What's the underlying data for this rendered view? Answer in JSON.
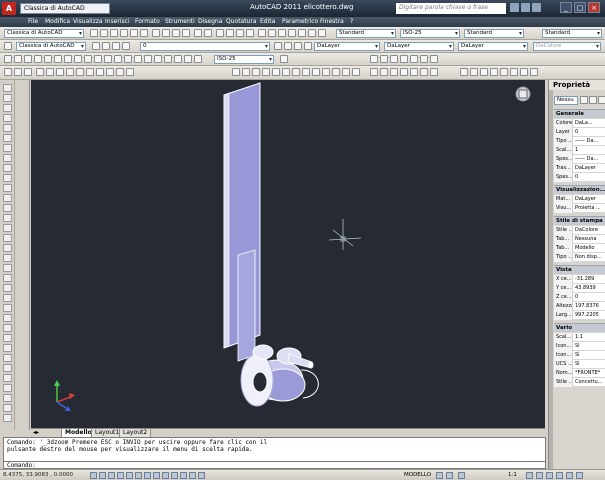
{
  "titlebar": {
    "workspace": "Classica di AutoCAD",
    "title": "AutoCAD 2011   elicottero.dwg",
    "search_placeholder": "Digitare parola chiave o frase",
    "logo": "A"
  },
  "menu": [
    "File",
    "Modifica",
    "Visualizza",
    "Inserisci",
    "Formato",
    "Strumenti",
    "Disegna",
    "Quotatura",
    "Edita",
    "Parametrico",
    "Finestra",
    "?"
  ],
  "toolbars": {
    "workspace_combo": "Classica di AutoCAD",
    "layer_combo": "0",
    "textstyle_combo": "Standard",
    "dimstyle_combo": "ISO-25",
    "tablestyle_combo": "Standard",
    "mleader_combo": "Standard",
    "color_combo": "DaLayer",
    "linetype_combo": "DaLayer",
    "lineweight_combo": "DaLayer",
    "plotstyle_combo": "DaColore",
    "iso_combo": "ISO-25"
  },
  "tabs": [
    "Modello",
    "Layout1",
    "Layout2"
  ],
  "command": {
    "history_line1": "Comando: '_3dzoom Premere ESC o INVIO per uscire oppure fare clic con il",
    "history_line2": "pulsante destro del mouse per visualizzare il menu di scelta rapida.",
    "prompt": "Comando:"
  },
  "status": {
    "coords": "8.4375, 33.9083 , 0.0000",
    "model_label": "MODELLO",
    "scale": "1:1"
  },
  "properties": {
    "title": "Proprietà",
    "selection": "Nessu",
    "sections": [
      {
        "name": "Generale",
        "rows": [
          {
            "k": "Colore",
            "v": "DaLa..."
          },
          {
            "k": "Layer",
            "v": "0"
          },
          {
            "k": "Tipo ...",
            "v": "—— Da..."
          },
          {
            "k": "Scal...",
            "v": "1"
          },
          {
            "k": "Spes...",
            "v": "—— Da..."
          },
          {
            "k": "Tras...",
            "v": "DaLayer"
          },
          {
            "k": "Spes...",
            "v": "0"
          }
        ]
      },
      {
        "name": "Visualizzazion...",
        "rows": [
          {
            "k": "Mat...",
            "v": "DaLayer"
          },
          {
            "k": "Visu...",
            "v": "Proietta ..."
          }
        ]
      },
      {
        "name": "Stile di stampa",
        "rows": [
          {
            "k": "Stile ...",
            "v": "DaColore"
          },
          {
            "k": "Tab...",
            "v": "Nessuna"
          },
          {
            "k": "Tab...",
            "v": "Modello"
          },
          {
            "k": "Tipo ...",
            "v": "Non disp..."
          }
        ]
      },
      {
        "name": "Vista",
        "rows": [
          {
            "k": "X ce...",
            "v": "-31.289"
          },
          {
            "k": "Y ce...",
            "v": "43.8939"
          },
          {
            "k": "Z ce...",
            "v": "0"
          },
          {
            "k": "Altezza",
            "v": "197.8376"
          },
          {
            "k": "Larg...",
            "v": "997.2205"
          }
        ]
      },
      {
        "name": "Vario",
        "rows": [
          {
            "k": "Scal...",
            "v": "1:1"
          },
          {
            "k": "Icon...",
            "v": "Sì"
          },
          {
            "k": "Icon...",
            "v": "Sì"
          },
          {
            "k": "UCS ...",
            "v": "Sì"
          },
          {
            "k": "Nom...",
            "v": "*FRONTE*"
          },
          {
            "k": "Stile ...",
            "v": "Concettu..."
          }
        ]
      }
    ]
  },
  "colors": {
    "viewport_bg": "#252a33",
    "model_fill": "#9a9ad8",
    "model_light": "#e0e0f4"
  }
}
